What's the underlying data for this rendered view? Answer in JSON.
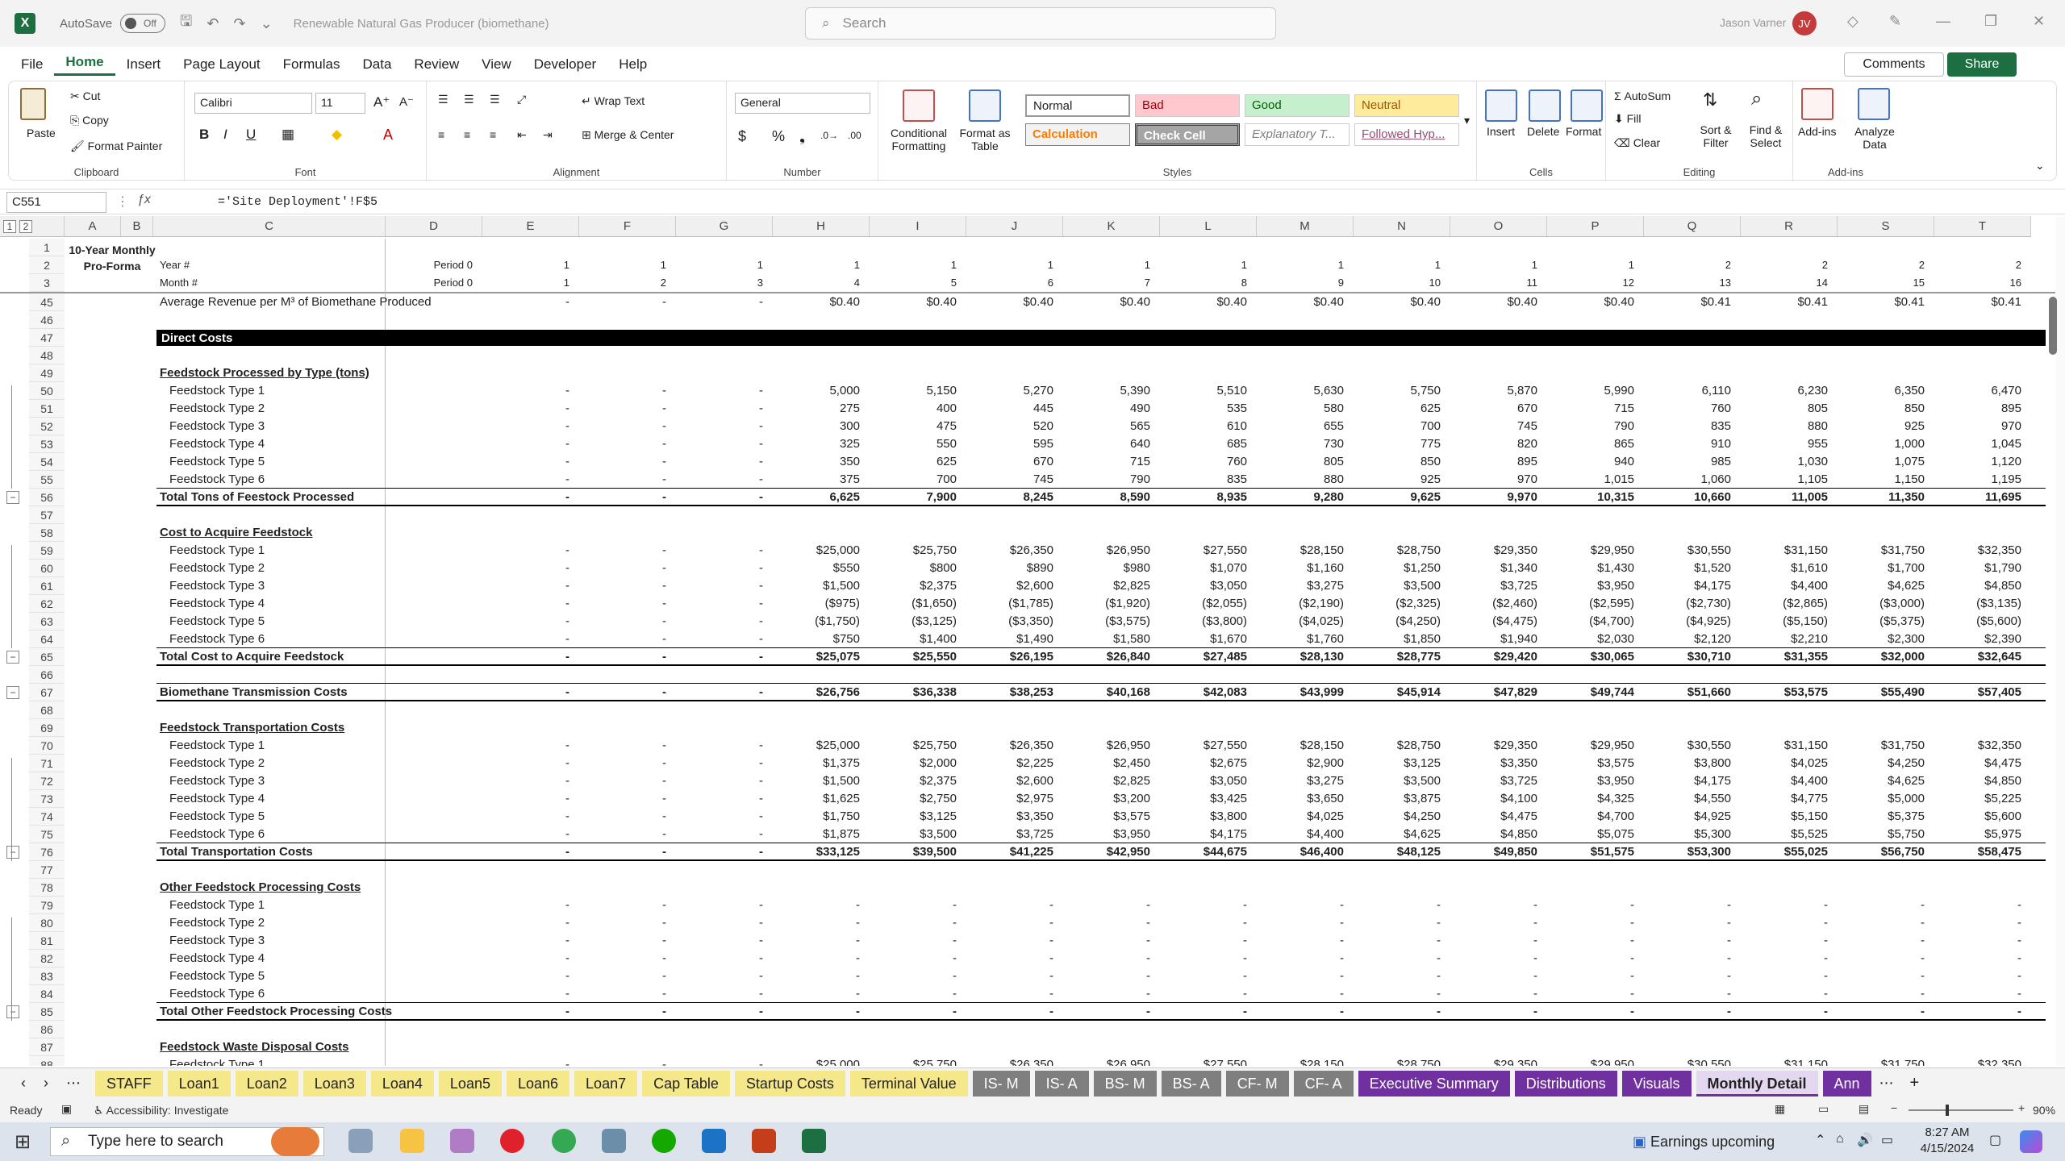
{
  "title_bar": {
    "autosave_label": "AutoSave",
    "autosave_state": "Off",
    "document_title": "Renewable Natural Gas Producer (biomethane)",
    "search_placeholder": "Search",
    "user_name": "Jason Varner",
    "user_initials": "JV"
  },
  "menu": [
    "File",
    "Home",
    "Insert",
    "Page Layout",
    "Formulas",
    "Data",
    "Review",
    "View",
    "Developer",
    "Help"
  ],
  "menu_active": "Home",
  "comments_label": "Comments",
  "share_label": "Share",
  "ribbon": {
    "clipboard": {
      "paste": "Paste",
      "cut": "Cut",
      "copy": "Copy",
      "format_painter": "Format Painter",
      "label": "Clipboard"
    },
    "font": {
      "name": "Calibri",
      "size": "11",
      "label": "Font"
    },
    "alignment": {
      "wrap": "Wrap Text",
      "merge": "Merge & Center",
      "label": "Alignment"
    },
    "number": {
      "format": "General",
      "label": "Number"
    },
    "styles": {
      "conditional": "Conditional Formatting",
      "format_table": "Format as Table",
      "normal": "Normal",
      "bad": "Bad",
      "good": "Good",
      "neutral": "Neutral",
      "calculation": "Calculation",
      "check_cell": "Check Cell",
      "explanatory": "Explanatory T...",
      "followed": "Followed Hyp...",
      "label": "Styles"
    },
    "cells": {
      "insert": "Insert",
      "delete": "Delete",
      "format": "Format",
      "label": "Cells"
    },
    "editing": {
      "autosum": "AutoSum",
      "fill": "Fill",
      "clear": "Clear",
      "sort": "Sort & Filter",
      "find": "Find & Select",
      "label": "Editing"
    },
    "addins": {
      "addins": "Add-ins",
      "analyze": "Analyze Data",
      "label": "Add-ins"
    }
  },
  "formula_bar": {
    "name_box": "C551",
    "formula": "='Site Deployment'!F$5"
  },
  "columns": [
    "A",
    "B",
    "C",
    "D",
    "E",
    "F",
    "G",
    "H",
    "I",
    "J",
    "K",
    "L",
    "M",
    "N",
    "O",
    "P",
    "Q",
    "R",
    "S",
    "T"
  ],
  "header_rows": {
    "title": "10-Year Monthly Pro-Forma",
    "year_label": "Year #",
    "month_label": "Month #",
    "period_year": "Period 0",
    "period_month": "Period 0",
    "years": [
      "1",
      "1",
      "1",
      "1",
      "1",
      "1",
      "1",
      "1",
      "1",
      "1",
      "1",
      "1",
      "2",
      "2",
      "2",
      "2"
    ],
    "months": [
      "1",
      "2",
      "3",
      "4",
      "5",
      "6",
      "7",
      "8",
      "9",
      "10",
      "11",
      "12",
      "13",
      "14",
      "15",
      "16"
    ]
  },
  "rows": [
    {
      "n": "45",
      "label": "Average Revenue per M³ of Biomethane Produced",
      "style": "plain",
      "vals": [
        "-",
        "-",
        "-",
        "$0.40",
        "$0.40",
        "$0.40",
        "$0.40",
        "$0.40",
        "$0.40",
        "$0.40",
        "$0.40",
        "$0.40",
        "$0.41",
        "$0.41",
        "$0.41",
        "$0.41"
      ]
    },
    {
      "n": "46",
      "label": "",
      "style": "blank",
      "vals": []
    },
    {
      "n": "47",
      "label": "Direct Costs",
      "style": "section",
      "vals": []
    },
    {
      "n": "48",
      "label": "",
      "style": "blank",
      "vals": []
    },
    {
      "n": "49",
      "label": "Feedstock Processed by Type (tons)",
      "style": "header",
      "vals": []
    },
    {
      "n": "50",
      "label": "Feedstock Type 1",
      "style": "item",
      "vals": [
        "-",
        "-",
        "-",
        "5,000",
        "5,150",
        "5,270",
        "5,390",
        "5,510",
        "5,630",
        "5,750",
        "5,870",
        "5,990",
        "6,110",
        "6,230",
        "6,350",
        "6,470"
      ]
    },
    {
      "n": "51",
      "label": "Feedstock Type 2",
      "style": "item",
      "vals": [
        "-",
        "-",
        "-",
        "275",
        "400",
        "445",
        "490",
        "535",
        "580",
        "625",
        "670",
        "715",
        "760",
        "805",
        "850",
        "895"
      ]
    },
    {
      "n": "52",
      "label": "Feedstock Type 3",
      "style": "item",
      "vals": [
        "-",
        "-",
        "-",
        "300",
        "475",
        "520",
        "565",
        "610",
        "655",
        "700",
        "745",
        "790",
        "835",
        "880",
        "925",
        "970"
      ]
    },
    {
      "n": "53",
      "label": "Feedstock Type 4",
      "style": "item",
      "vals": [
        "-",
        "-",
        "-",
        "325",
        "550",
        "595",
        "640",
        "685",
        "730",
        "775",
        "820",
        "865",
        "910",
        "955",
        "1,000",
        "1,045"
      ]
    },
    {
      "n": "54",
      "label": "Feedstock Type 5",
      "style": "item",
      "vals": [
        "-",
        "-",
        "-",
        "350",
        "625",
        "670",
        "715",
        "760",
        "805",
        "850",
        "895",
        "940",
        "985",
        "1,030",
        "1,075",
        "1,120"
      ]
    },
    {
      "n": "55",
      "label": "Feedstock Type 6",
      "style": "item",
      "vals": [
        "-",
        "-",
        "-",
        "375",
        "700",
        "745",
        "790",
        "835",
        "880",
        "925",
        "970",
        "1,015",
        "1,060",
        "1,105",
        "1,150",
        "1,195"
      ]
    },
    {
      "n": "56",
      "label": "Total Tons of Feestock Processed",
      "style": "total",
      "vals": [
        "-",
        "-",
        "-",
        "6,625",
        "7,900",
        "8,245",
        "8,590",
        "8,935",
        "9,280",
        "9,625",
        "9,970",
        "10,315",
        "10,660",
        "11,005",
        "11,350",
        "11,695"
      ]
    },
    {
      "n": "57",
      "label": "",
      "style": "blank",
      "vals": []
    },
    {
      "n": "58",
      "label": "Cost to Acquire Feedstock",
      "style": "header",
      "vals": []
    },
    {
      "n": "59",
      "label": "Feedstock Type 1",
      "style": "item",
      "vals": [
        "-",
        "-",
        "-",
        "$25,000",
        "$25,750",
        "$26,350",
        "$26,950",
        "$27,550",
        "$28,150",
        "$28,750",
        "$29,350",
        "$29,950",
        "$30,550",
        "$31,150",
        "$31,750",
        "$32,350"
      ]
    },
    {
      "n": "60",
      "label": "Feedstock Type 2",
      "style": "item",
      "vals": [
        "-",
        "-",
        "-",
        "$550",
        "$800",
        "$890",
        "$980",
        "$1,070",
        "$1,160",
        "$1,250",
        "$1,340",
        "$1,430",
        "$1,520",
        "$1,610",
        "$1,700",
        "$1,790"
      ]
    },
    {
      "n": "61",
      "label": "Feedstock Type 3",
      "style": "item",
      "vals": [
        "-",
        "-",
        "-",
        "$1,500",
        "$2,375",
        "$2,600",
        "$2,825",
        "$3,050",
        "$3,275",
        "$3,500",
        "$3,725",
        "$3,950",
        "$4,175",
        "$4,400",
        "$4,625",
        "$4,850"
      ]
    },
    {
      "n": "62",
      "label": "Feedstock Type 4",
      "style": "item",
      "vals": [
        "-",
        "-",
        "-",
        "($975)",
        "($1,650)",
        "($1,785)",
        "($1,920)",
        "($2,055)",
        "($2,190)",
        "($2,325)",
        "($2,460)",
        "($2,595)",
        "($2,730)",
        "($2,865)",
        "($3,000)",
        "($3,135)"
      ]
    },
    {
      "n": "63",
      "label": "Feedstock Type 5",
      "style": "item",
      "vals": [
        "-",
        "-",
        "-",
        "($1,750)",
        "($3,125)",
        "($3,350)",
        "($3,575)",
        "($3,800)",
        "($4,025)",
        "($4,250)",
        "($4,475)",
        "($4,700)",
        "($4,925)",
        "($5,150)",
        "($5,375)",
        "($5,600)"
      ]
    },
    {
      "n": "64",
      "label": "Feedstock Type 6",
      "style": "item",
      "vals": [
        "-",
        "-",
        "-",
        "$750",
        "$1,400",
        "$1,490",
        "$1,580",
        "$1,670",
        "$1,760",
        "$1,850",
        "$1,940",
        "$2,030",
        "$2,120",
        "$2,210",
        "$2,300",
        "$2,390"
      ]
    },
    {
      "n": "65",
      "label": "Total Cost to Acquire Feedstock",
      "style": "total",
      "vals": [
        "-",
        "-",
        "-",
        "$25,075",
        "$25,550",
        "$26,195",
        "$26,840",
        "$27,485",
        "$28,130",
        "$28,775",
        "$29,420",
        "$30,065",
        "$30,710",
        "$31,355",
        "$32,000",
        "$32,645"
      ]
    },
    {
      "n": "66",
      "label": "",
      "style": "blank",
      "vals": []
    },
    {
      "n": "67",
      "label": "Biomethane Transmission Costs",
      "style": "total",
      "vals": [
        "-",
        "-",
        "-",
        "$26,756",
        "$36,338",
        "$38,253",
        "$40,168",
        "$42,083",
        "$43,999",
        "$45,914",
        "$47,829",
        "$49,744",
        "$51,660",
        "$53,575",
        "$55,490",
        "$57,405"
      ]
    },
    {
      "n": "68",
      "label": "",
      "style": "blank",
      "vals": []
    },
    {
      "n": "69",
      "label": "Feedstock Transportation Costs",
      "style": "header",
      "vals": []
    },
    {
      "n": "70",
      "label": "Feedstock Type 1",
      "style": "item",
      "vals": [
        "-",
        "-",
        "-",
        "$25,000",
        "$25,750",
        "$26,350",
        "$26,950",
        "$27,550",
        "$28,150",
        "$28,750",
        "$29,350",
        "$29,950",
        "$30,550",
        "$31,150",
        "$31,750",
        "$32,350"
      ]
    },
    {
      "n": "71",
      "label": "Feedstock Type 2",
      "style": "item",
      "vals": [
        "-",
        "-",
        "-",
        "$1,375",
        "$2,000",
        "$2,225",
        "$2,450",
        "$2,675",
        "$2,900",
        "$3,125",
        "$3,350",
        "$3,575",
        "$3,800",
        "$4,025",
        "$4,250",
        "$4,475"
      ]
    },
    {
      "n": "72",
      "label": "Feedstock Type 3",
      "style": "item",
      "vals": [
        "-",
        "-",
        "-",
        "$1,500",
        "$2,375",
        "$2,600",
        "$2,825",
        "$3,050",
        "$3,275",
        "$3,500",
        "$3,725",
        "$3,950",
        "$4,175",
        "$4,400",
        "$4,625",
        "$4,850"
      ]
    },
    {
      "n": "73",
      "label": "Feedstock Type 4",
      "style": "item",
      "vals": [
        "-",
        "-",
        "-",
        "$1,625",
        "$2,750",
        "$2,975",
        "$3,200",
        "$3,425",
        "$3,650",
        "$3,875",
        "$4,100",
        "$4,325",
        "$4,550",
        "$4,775",
        "$5,000",
        "$5,225"
      ]
    },
    {
      "n": "74",
      "label": "Feedstock Type 5",
      "style": "item",
      "vals": [
        "-",
        "-",
        "-",
        "$1,750",
        "$3,125",
        "$3,350",
        "$3,575",
        "$3,800",
        "$4,025",
        "$4,250",
        "$4,475",
        "$4,700",
        "$4,925",
        "$5,150",
        "$5,375",
        "$5,600"
      ]
    },
    {
      "n": "75",
      "label": "Feedstock Type 6",
      "style": "item",
      "vals": [
        "-",
        "-",
        "-",
        "$1,875",
        "$3,500",
        "$3,725",
        "$3,950",
        "$4,175",
        "$4,400",
        "$4,625",
        "$4,850",
        "$5,075",
        "$5,300",
        "$5,525",
        "$5,750",
        "$5,975"
      ]
    },
    {
      "n": "76",
      "label": "Total Transportation Costs",
      "style": "total",
      "vals": [
        "-",
        "-",
        "-",
        "$33,125",
        "$39,500",
        "$41,225",
        "$42,950",
        "$44,675",
        "$46,400",
        "$48,125",
        "$49,850",
        "$51,575",
        "$53,300",
        "$55,025",
        "$56,750",
        "$58,475"
      ]
    },
    {
      "n": "77",
      "label": "",
      "style": "blank",
      "vals": []
    },
    {
      "n": "78",
      "label": "Other Feedstock Processing Costs",
      "style": "header",
      "vals": []
    },
    {
      "n": "79",
      "label": "Feedstock Type 1",
      "style": "item",
      "vals": [
        "-",
        "-",
        "-",
        "-",
        "-",
        "-",
        "-",
        "-",
        "-",
        "-",
        "-",
        "-",
        "-",
        "-",
        "-",
        "-"
      ]
    },
    {
      "n": "80",
      "label": "Feedstock Type 2",
      "style": "item",
      "vals": [
        "-",
        "-",
        "-",
        "-",
        "-",
        "-",
        "-",
        "-",
        "-",
        "-",
        "-",
        "-",
        "-",
        "-",
        "-",
        "-"
      ]
    },
    {
      "n": "81",
      "label": "Feedstock Type 3",
      "style": "item",
      "vals": [
        "-",
        "-",
        "-",
        "-",
        "-",
        "-",
        "-",
        "-",
        "-",
        "-",
        "-",
        "-",
        "-",
        "-",
        "-",
        "-"
      ]
    },
    {
      "n": "82",
      "label": "Feedstock Type 4",
      "style": "item",
      "vals": [
        "-",
        "-",
        "-",
        "-",
        "-",
        "-",
        "-",
        "-",
        "-",
        "-",
        "-",
        "-",
        "-",
        "-",
        "-",
        "-"
      ]
    },
    {
      "n": "83",
      "label": "Feedstock Type 5",
      "style": "item",
      "vals": [
        "-",
        "-",
        "-",
        "-",
        "-",
        "-",
        "-",
        "-",
        "-",
        "-",
        "-",
        "-",
        "-",
        "-",
        "-",
        "-"
      ]
    },
    {
      "n": "84",
      "label": "Feedstock Type 6",
      "style": "item",
      "vals": [
        "-",
        "-",
        "-",
        "-",
        "-",
        "-",
        "-",
        "-",
        "-",
        "-",
        "-",
        "-",
        "-",
        "-",
        "-",
        "-"
      ]
    },
    {
      "n": "85",
      "label": "Total Other Feedstock Processing Costs",
      "style": "total",
      "vals": [
        "-",
        "-",
        "-",
        "-",
        "-",
        "-",
        "-",
        "-",
        "-",
        "-",
        "-",
        "-",
        "-",
        "-",
        "-",
        "-"
      ]
    },
    {
      "n": "86",
      "label": "",
      "style": "blank",
      "vals": []
    },
    {
      "n": "87",
      "label": "Feedstock Waste Disposal Costs",
      "style": "header",
      "vals": []
    },
    {
      "n": "88",
      "label": "Feedstock Type 1",
      "style": "item",
      "vals": [
        "-",
        "-",
        "-",
        "$25,000",
        "$25,750",
        "$26,350",
        "$26,950",
        "$27,550",
        "$28,150",
        "$28,750",
        "$29,350",
        "$29,950",
        "$30,550",
        "$31,150",
        "$31,750",
        "$32,350"
      ]
    }
  ],
  "sheet_tabs": [
    {
      "label": "STAFF",
      "bg": "#f5e88a"
    },
    {
      "label": "Loan1",
      "bg": "#f5e88a"
    },
    {
      "label": "Loan2",
      "bg": "#f5e88a"
    },
    {
      "label": "Loan3",
      "bg": "#f5e88a"
    },
    {
      "label": "Loan4",
      "bg": "#f5e88a"
    },
    {
      "label": "Loan5",
      "bg": "#f5e88a"
    },
    {
      "label": "Loan6",
      "bg": "#f5e88a"
    },
    {
      "label": "Loan7",
      "bg": "#f5e88a"
    },
    {
      "label": "Cap Table",
      "bg": "#f5e88a"
    },
    {
      "label": "Startup Costs",
      "bg": "#f5e88a"
    },
    {
      "label": "Terminal Value",
      "bg": "#f5e88a"
    },
    {
      "label": "IS- M",
      "bg": "#7f7f7f"
    },
    {
      "label": "IS- A",
      "bg": "#7f7f7f"
    },
    {
      "label": "BS- M",
      "bg": "#7f7f7f"
    },
    {
      "label": "BS- A",
      "bg": "#7f7f7f"
    },
    {
      "label": "CF- M",
      "bg": "#7f7f7f"
    },
    {
      "label": "CF- A",
      "bg": "#7f7f7f"
    },
    {
      "label": "Executive Summary",
      "bg": "#7030a0"
    },
    {
      "label": "Distributions",
      "bg": "#7030a0"
    },
    {
      "label": "Visuals",
      "bg": "#7030a0"
    },
    {
      "label": "Monthly Detail",
      "bg": "#e4d7f0"
    },
    {
      "label": "Ann",
      "bg": "#7030a0"
    }
  ],
  "status": {
    "ready": "Ready",
    "accessibility": "Accessibility: Investigate",
    "zoom": "90%"
  },
  "taskbar": {
    "search_placeholder": "Type here to search",
    "weather": "Earnings upcoming",
    "time": "8:27 AM",
    "date": "4/15/2024"
  }
}
